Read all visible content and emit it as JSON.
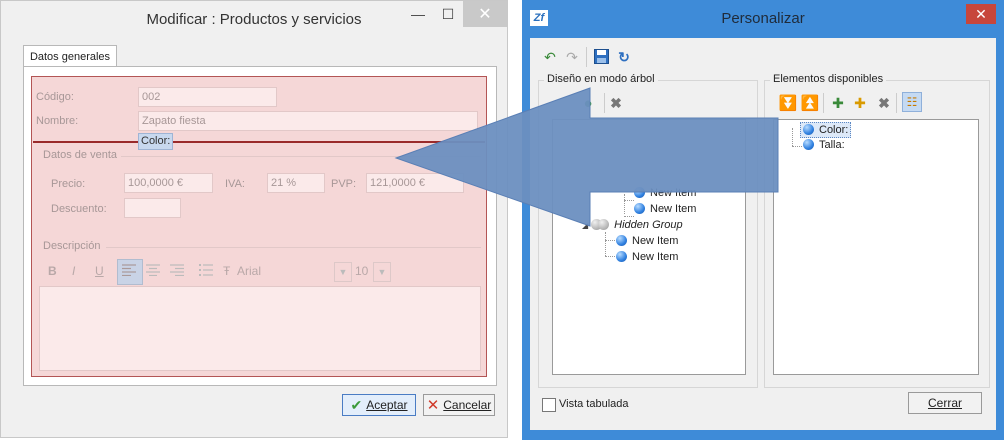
{
  "left_window": {
    "title": "Modificar : Productos y servicios",
    "controls": {
      "minimize": "—",
      "maximize": "☐",
      "close": "✕"
    },
    "tab": "Datos generales",
    "fields": {
      "codigo_label": "Código:",
      "codigo_value": "002",
      "nombre_label": "Nombre:",
      "nombre_value": "Zapato fiesta",
      "dragged_label": "Color:",
      "venta_section": "Datos de venta",
      "precio_label": "Precio:",
      "precio_value": "100,0000 €",
      "iva_label": "IVA:",
      "iva_value": "21 %",
      "pvp_label": "PVP:",
      "pvp_value": "121,0000 €",
      "descuento_label": "Descuento:",
      "descuento_value": "",
      "descripcion_section": "Descripción"
    },
    "format_toolbar": {
      "bold": "B",
      "italic": "I",
      "underline": "U",
      "font": "Arial",
      "size": "10",
      "font_glyph": "Ŧ"
    },
    "buttons": {
      "ok": "Aceptar",
      "cancel": "Cancelar"
    }
  },
  "right_window": {
    "title": "Personalizar",
    "logo": "Zf",
    "close": "✕",
    "tree_group": "Diseño en modo árbol",
    "available_group": "Elementos disponibles",
    "tree_items": [
      "New Item",
      "New Item",
      "Hidden Group",
      "New Item",
      "New Item"
    ],
    "available_items": [
      "Color:",
      "Talla:"
    ],
    "tabbed_view_label": "Vista tabulada",
    "close_button": "Cerrar",
    "colors": {
      "accent": "#3e8bd8",
      "arrow": "#6b8fc0"
    }
  }
}
